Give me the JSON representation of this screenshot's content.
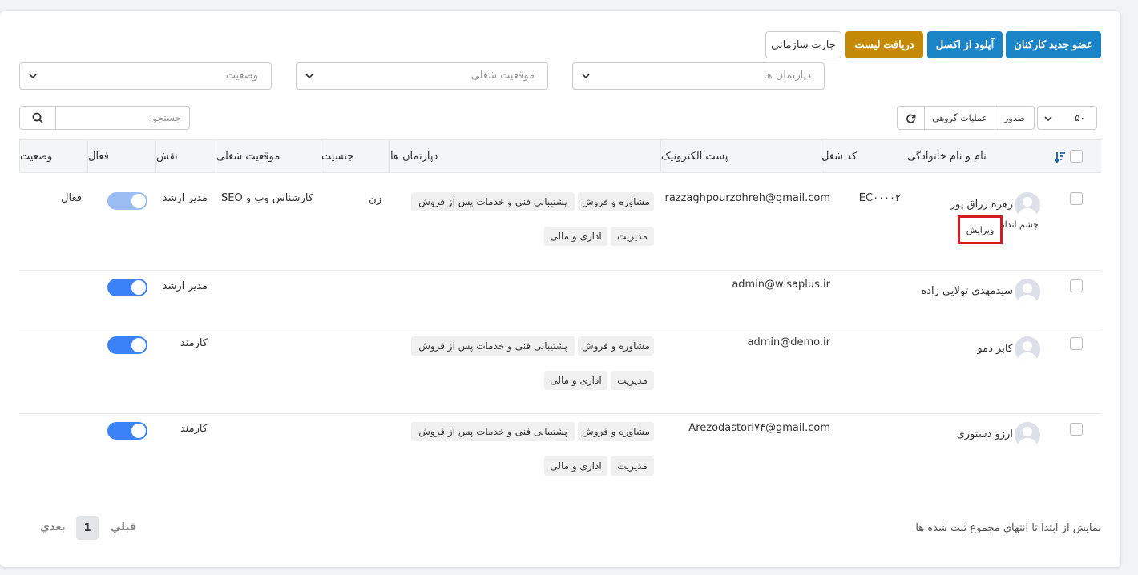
{
  "toolbar": {
    "new_member": "عضو جدید کارکنان",
    "upload_excel": "آپلود از اکسل",
    "download_list": "دریافت لیست",
    "org_chart": "چارت سازمانی"
  },
  "filters": {
    "departments": "دپارتمان ها",
    "job_position": "موقعیت شغلی",
    "status": "وضعیت"
  },
  "search": {
    "placeholder": "جستجو:"
  },
  "table_tools": {
    "page_size": "۵۰",
    "export": "صدور",
    "bulk_ops": "عملیات گروهی"
  },
  "columns": {
    "name": "نام و نام خانوادگی",
    "job_code": "کد شغل",
    "email": "پست الکترونیک",
    "departments": "دپارتمان ها",
    "gender": "جنسیت",
    "job_position": "موقعیت شغلی",
    "role": "نقش",
    "active": "فعال",
    "status": "وضعیت"
  },
  "rows": [
    {
      "name": "زهره رزاق پور",
      "sub_label": "چشم انداز",
      "edit": "ویرایش",
      "job_code": "EC۰۰۰۰۲",
      "email": "razzaghpourzohreh@gmail.com",
      "dept_tags": [
        "مشاوره و فروش",
        "پشتیبانی فنی و خدمات پس از فروش",
        "مدیریت",
        "اداری و مالی"
      ],
      "gender": "زن",
      "job_position": "کارشناس وب و SEO",
      "role": "مدیر ارشد",
      "active": true,
      "status": "فعال"
    },
    {
      "name": "سیدمهدی تولایی زاده",
      "email": "admin@wisaplus.ir",
      "dept_tags": [],
      "role": "مدیر ارشد",
      "active": true
    },
    {
      "name": "کابر دمو",
      "email": "admin@demo.ir",
      "dept_tags": [
        "مشاوره و فروش",
        "پشتیبانی فنی و خدمات پس از فروش",
        "مدیریت",
        "اداری و مالی"
      ],
      "role": "کارمند",
      "active": true
    },
    {
      "name": "ارزو دستوری",
      "email": "Arezodastori۷۴@gmail.com",
      "dept_tags": [
        "مشاوره و فروش",
        "پشتیبانی فنی و خدمات پس از فروش",
        "مدیریت",
        "اداری و مالی"
      ],
      "role": "کارمند",
      "active": true
    }
  ],
  "footer": {
    "summary": "نمایش از ابتدا تا انتهاي مجموع ثبت شده ها",
    "prev": "قبلي",
    "page": "1",
    "next": "بعدي"
  }
}
